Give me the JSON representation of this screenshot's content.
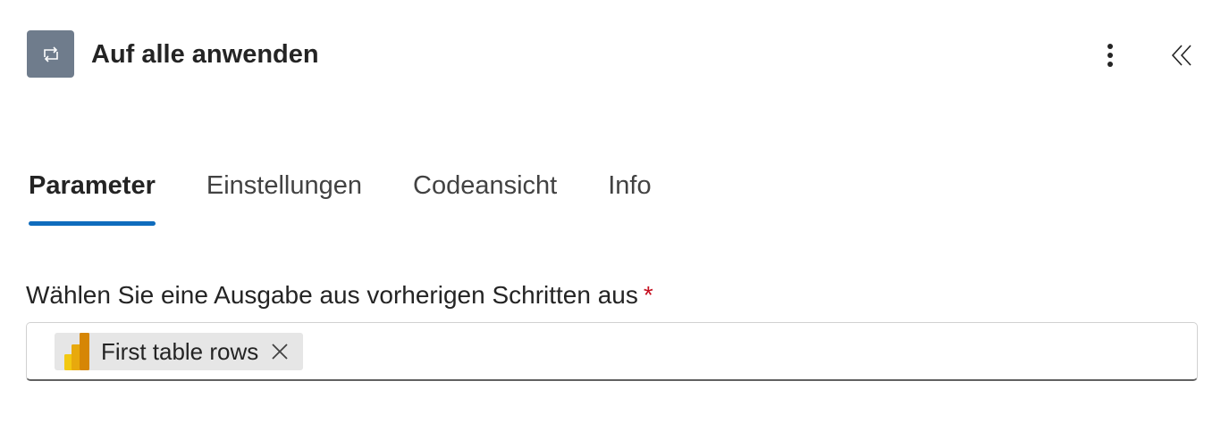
{
  "header": {
    "title": "Auf alle anwenden",
    "icon": "loop-icon",
    "icon_bg_color": "#6f7c8c",
    "more_icon": "more-vertical-icon",
    "collapse_icon": "chevron-double-left-icon"
  },
  "tabs": [
    {
      "label": "Parameter",
      "active": true
    },
    {
      "label": "Einstellungen",
      "active": false
    },
    {
      "label": "Codeansicht",
      "active": false
    },
    {
      "label": "Info",
      "active": false
    }
  ],
  "accent_color": "#0f6cbd",
  "field": {
    "label": "Wählen Sie eine Ausgabe aus vorherigen Schritten aus",
    "required_marker": "*",
    "token": {
      "label": "First table rows",
      "icon": "power-bi-icon",
      "remove_icon": "close-icon"
    }
  }
}
